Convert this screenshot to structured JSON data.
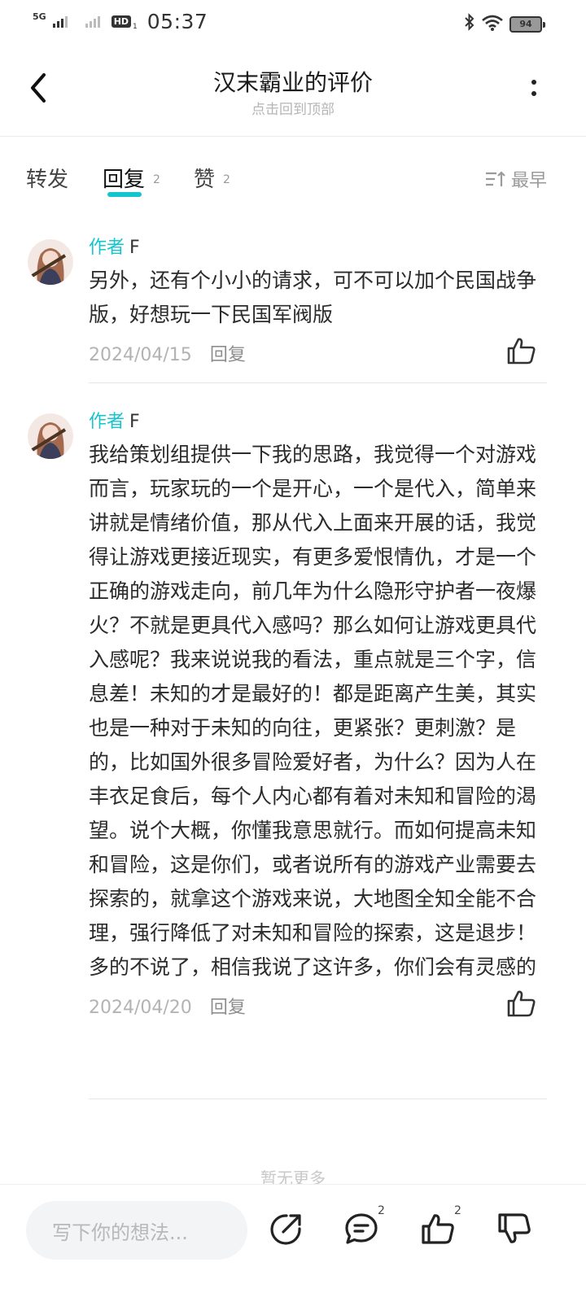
{
  "status_bar": {
    "network": "5G",
    "hd": "HD",
    "hd_sub": "1",
    "time": "05:37",
    "battery": "94"
  },
  "header": {
    "title": "汉末霸业的评价",
    "subtitle": "点击回到顶部"
  },
  "tabs": [
    {
      "label": "转发",
      "count": ""
    },
    {
      "label": "回复",
      "count": "2"
    },
    {
      "label": "赞",
      "count": "2"
    }
  ],
  "sort_label": "最早",
  "comments": [
    {
      "author_tag": "作者",
      "author_name": "F",
      "content": "另外，还有个小小的请求，可不可以加个民国战争版，好想玩一下民国军阀版",
      "date": "2024/04/15",
      "reply_label": "回复"
    },
    {
      "author_tag": "作者",
      "author_name": "F",
      "content": "我给策划组提供一下我的思路，我觉得一个对游戏而言，玩家玩的一个是开心，一个是代入，简单来讲就是情绪价值，那从代入上面来开展的话，我觉得让游戏更接近现实，有更多爱恨情仇，才是一个正确的游戏走向，前几年为什么隐形守护者一夜爆火？不就是更具代入感吗？那么如何让游戏更具代入感呢？我来说说我的看法，重点就是三个字，信息差！未知的才是最好的！都是距离产生美，其实也是一种对于未知的向往，更紧张？更刺激？是的，比如国外很多冒险爱好者，为什么？因为人在丰衣足食后，每个人内心都有着对未知和冒险的渴望。说个大概，你懂我意思就行。而如何提高未知和冒险，这是你们，或者说所有的游戏产业需要去探索的，就拿这个游戏来说，大地图全知全能不合理，强行降低了对未知和冒险的探索，这是退步！多的不说了，相信我说了这许多，你们会有灵感的",
      "date": "2024/04/20",
      "reply_label": "回复"
    }
  ],
  "no_more": "暂无更多",
  "bottom": {
    "input_placeholder": "写下你的想法...",
    "comment_count": "2",
    "like_count": "2"
  },
  "colors": {
    "accent": "#15c5ce",
    "muted": "#b3b3b3"
  },
  "icons": [
    "back-icon",
    "more-icon",
    "sort-icon",
    "like-icon",
    "share-icon",
    "comment-icon",
    "dislike-icon",
    "bluetooth-icon",
    "wifi-icon",
    "battery-icon"
  ]
}
